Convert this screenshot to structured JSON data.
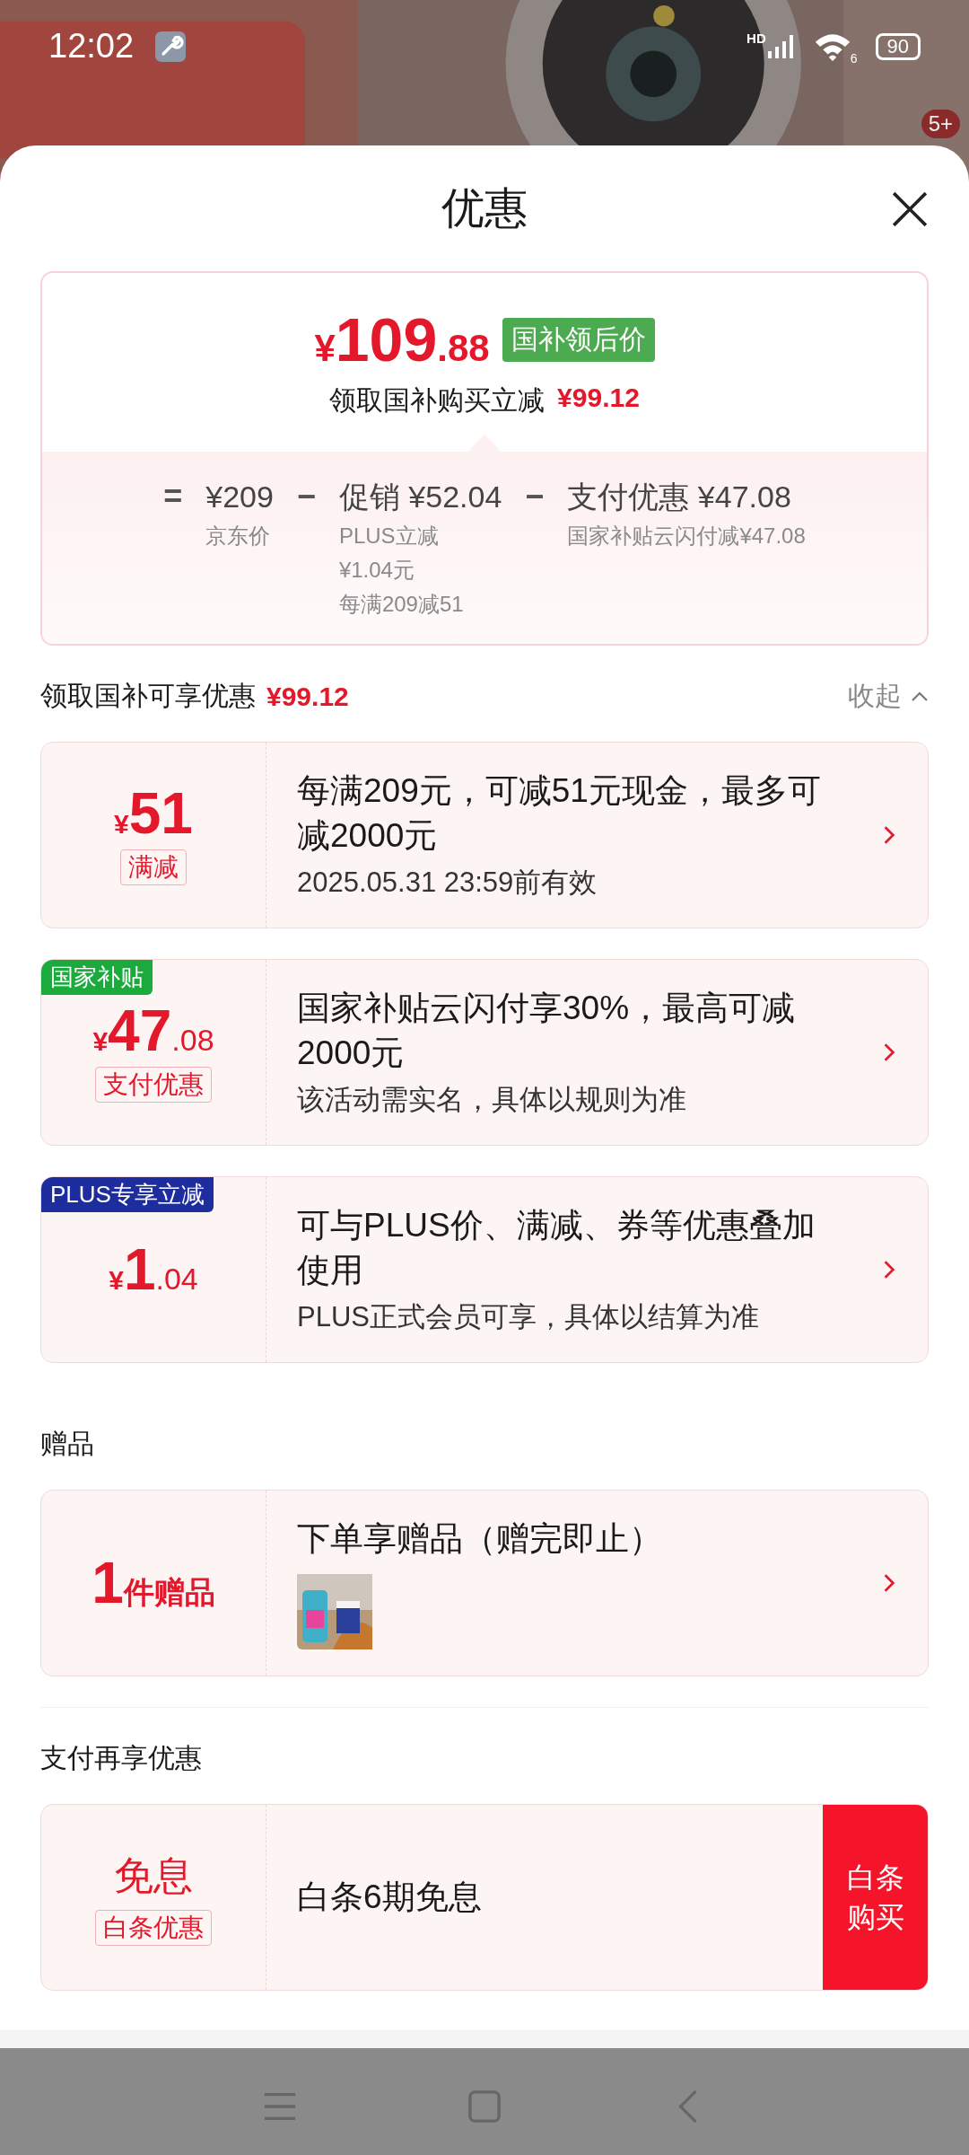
{
  "status_bar": {
    "time": "12:02",
    "network_label": "HD",
    "wifi_label": "6",
    "battery": "90"
  },
  "background": {
    "kind": "picture",
    "badge": "5+"
  },
  "sheet": {
    "title": "优惠"
  },
  "summary": {
    "price": {
      "symbol": "¥",
      "integer": "109",
      "decimal": ".88"
    },
    "tag": "国补领后价",
    "saving_label": "领取国补购买立减",
    "saving": "¥99.12",
    "breakdown": [
      {
        "operator": "=",
        "amount": "¥209",
        "notes": [
          "京东价"
        ]
      },
      {
        "operator": "−",
        "title": "促销",
        "amount": "¥52.04",
        "notes": [
          "PLUS立减",
          "¥1.04元",
          "每满209减51"
        ]
      },
      {
        "operator": "−",
        "title": "支付优惠",
        "amount": "¥47.08",
        "notes": [
          "国家补贴云闪付减¥47.08"
        ]
      }
    ]
  },
  "sections": [
    {
      "title": "领取国补可享优惠",
      "amount": "¥99.12",
      "toggle": {
        "label": "收起",
        "expanded": true
      },
      "offers": [
        {
          "kind": "amount",
          "amount": {
            "symbol": "¥",
            "integer": "51"
          },
          "tag": "满减",
          "title": "每满209元，可减51元现金，最多可减2000元",
          "subtitle": "2025.05.31 23:59前有效"
        },
        {
          "kind": "amount",
          "badge": {
            "label": "国家补贴",
            "color": "#1aab3c"
          },
          "amount": {
            "symbol": "¥",
            "integer": "47",
            "decimal": ".08"
          },
          "tag": "支付优惠",
          "title": "国家补贴云闪付享30%，最高可减2000元",
          "subtitle": "该活动需实名，具体以规则为准"
        },
        {
          "kind": "amount",
          "badge": {
            "label": "PLUS专享立减",
            "color": "#1e2d9e"
          },
          "amount": {
            "symbol": "¥",
            "integer": "1",
            "decimal": ".04"
          },
          "title": "可与PLUS价、满减、券等优惠叠加使用",
          "subtitle": "PLUS正式会员可享，具体以结算为准"
        }
      ]
    },
    {
      "title": "赠品",
      "offers": [
        {
          "kind": "gift",
          "count": "1",
          "unit": "件赠品",
          "title": "下单享赠品（赠完即止）"
        }
      ]
    },
    {
      "title": "支付再享优惠",
      "offers": [
        {
          "kind": "text",
          "headline": "免息",
          "tag": "白条优惠",
          "title": "白条6期免息",
          "action": "白条购买"
        }
      ]
    }
  ]
}
